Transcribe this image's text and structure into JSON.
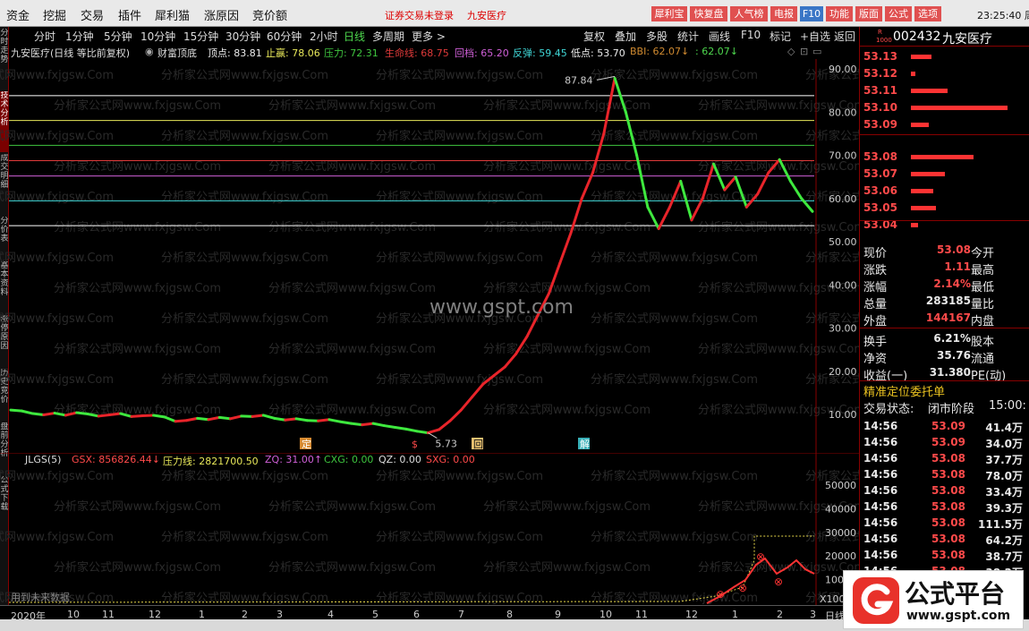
{
  "menu": {
    "items": [
      "资金",
      "挖掘",
      "交易",
      "插件",
      "犀利猫",
      "涨原因",
      "竞价额"
    ],
    "notice": "证券交易未登录",
    "notice_stock": "九安医疗",
    "buttons": [
      "犀利宝",
      "快复盘",
      "人气榜",
      "电报",
      "F10",
      "功能",
      "版面",
      "公式",
      "选项"
    ],
    "clock": "23:25:40 周一"
  },
  "side_tabs": [
    "分时走势",
    "技术分析",
    "成交明细",
    "分价表",
    "基本资料",
    "涨停原因",
    "历史竞价",
    "盘前分析",
    "公式下载"
  ],
  "periods": [
    "分时",
    "1分钟",
    "5分钟",
    "10分钟",
    "15分钟",
    "30分钟",
    "60分钟",
    "2小时",
    "日线",
    "多周期",
    "更多 >"
  ],
  "active_period": "日线",
  "toolbar": [
    "复权",
    "叠加",
    "多股",
    "统计",
    "画线",
    "F10",
    "标记",
    "+自选",
    "返回"
  ],
  "info": {
    "name": "九安医疗(日线 等比前复权)",
    "indicator": "财富顶底",
    "top": "顶点: 83.81",
    "stop_profit": "止赢: 78.06",
    "pressure": "压力: 72.31",
    "lifeline": "生命线: 68.75",
    "pullback": "回档: 65.20",
    "rebound": "反弹: 59.45",
    "low": "低点: 53.70",
    "bbi": "BBI: 62.07↓",
    "bbi2": ": 62.07↓"
  },
  "markers": [
    {
      "label": "定",
      "date": "2020-03"
    },
    {
      "label": "$",
      "date": "2020-06"
    },
    {
      "label": "回",
      "date": "2020-07"
    },
    {
      "label": "解",
      "date": "2020-10"
    }
  ],
  "annotations": {
    "high": "87.84",
    "low": "5.73"
  },
  "watermark": "www.gspt.com",
  "watermark_repeat": "分析家公式网www.fxjgsw.Com",
  "levels": [
    {
      "label": "顶点",
      "value": 83.81,
      "color": "#ffffff"
    },
    {
      "label": "止赢",
      "value": 78.06,
      "color": "#e8e85a"
    },
    {
      "label": "压力",
      "value": 72.31,
      "color": "#3fc63f"
    },
    {
      "label": "生命线",
      "value": 68.75,
      "color": "#e03a3a"
    },
    {
      "label": "回档",
      "value": 65.2,
      "color": "#d060d8"
    },
    {
      "label": "反弹",
      "value": 59.45,
      "color": "#40d8d8"
    },
    {
      "label": "低点",
      "value": 53.7,
      "color": "#ffffff"
    }
  ],
  "main_axis": [
    "90.00",
    "80.00",
    "70.00",
    "60.00",
    "50.00",
    "40.00",
    "30.00",
    "20.00",
    "10.00"
  ],
  "volume": {
    "indicator": "JLGS(5)",
    "gsx": "GSX: 856826.44↓",
    "pressure": "压力线: 2821700.50",
    "zq": "ZQ: 31.00↑",
    "cxg": "CXG: 0.00",
    "qz": "QZ: 0.00",
    "sxg": "SXG: 0.00",
    "axis": [
      "50000",
      "40000",
      "30000",
      "20000",
      "10000"
    ],
    "unit": "X100",
    "note": "用到未来数据"
  },
  "time_axis": [
    "2020年",
    "10",
    "11",
    "12",
    "1",
    "2",
    "3",
    "4",
    "5",
    "6",
    "7",
    "8",
    "9",
    "10",
    "11",
    "12",
    "1",
    "2",
    "3"
  ],
  "time_end": "日线",
  "stock": {
    "code": "002432",
    "name": "九安医疗",
    "badge_r": "R",
    "badge_n": "1000"
  },
  "orderbook": [
    {
      "price": "53.13",
      "vol": 18
    },
    {
      "price": "53.12",
      "vol": 4
    },
    {
      "price": "53.11",
      "vol": 32
    },
    {
      "price": "53.10",
      "vol": 85
    },
    {
      "price": "53.09",
      "vol": 16
    },
    {
      "price": "53.08",
      "vol": 55
    },
    {
      "price": "53.07",
      "vol": 30
    },
    {
      "price": "53.06",
      "vol": 20
    },
    {
      "price": "53.05",
      "vol": 22
    },
    {
      "price": "53.04",
      "vol": 6
    }
  ],
  "quote": [
    {
      "l": "现价",
      "v": "53.08",
      "r": "今开",
      "c": "#ff4a4a"
    },
    {
      "l": "涨跌",
      "v": "1.11",
      "r": "最高",
      "c": "#ff4a4a"
    },
    {
      "l": "涨幅",
      "v": "2.14%",
      "r": "最低",
      "c": "#ff4a4a"
    },
    {
      "l": "总量",
      "v": "283185",
      "r": "量比",
      "c": "#e8e8e8"
    },
    {
      "l": "外盘",
      "v": "144167",
      "r": "内盘",
      "c": "#ff4a4a"
    },
    {
      "l": "换手",
      "v": "6.21%",
      "r": "股本",
      "c": "#e8e8e8"
    },
    {
      "l": "净资",
      "v": "35.76",
      "r": "流通",
      "c": "#e8e8e8"
    },
    {
      "l": "收益(一)",
      "v": "31.380",
      "r": "PE(动)",
      "c": "#e8e8e8"
    }
  ],
  "order_title": "精准定位委托单",
  "trade_status_label": "交易状态:",
  "trade_status": "闭市阶段",
  "trade_time": "15:00:",
  "ticks": [
    {
      "t": "14:56",
      "p": "53.09",
      "v": "41.4万"
    },
    {
      "t": "14:56",
      "p": "53.09",
      "v": "34.0万"
    },
    {
      "t": "14:56",
      "p": "53.08",
      "v": "37.7万"
    },
    {
      "t": "14:56",
      "p": "53.08",
      "v": "78.0万"
    },
    {
      "t": "14:56",
      "p": "53.08",
      "v": "33.4万"
    },
    {
      "t": "14:56",
      "p": "53.08",
      "v": "39.3万"
    },
    {
      "t": "14:56",
      "p": "53.08",
      "v": "111.5万"
    },
    {
      "t": "14:56",
      "p": "53.08",
      "v": "64.2万"
    },
    {
      "t": "14:56",
      "p": "53.08",
      "v": "38.7万"
    },
    {
      "t": "14:56",
      "p": "53.08",
      "v": "38.2万"
    }
  ],
  "logo": {
    "text": "公式平台",
    "url": "www.gspt.com"
  },
  "price_series": [
    11,
    10.8,
    10.2,
    9.9,
    10.3,
    9.8,
    10.4,
    10.1,
    9.6,
    9.9,
    10.2,
    9.5,
    9.7,
    9.8,
    9.4,
    8.4,
    8.6,
    9.1,
    8.8,
    9.3,
    9.0,
    9.6,
    9.5,
    9.8,
    9.1,
    8.7,
    9.0,
    8.6,
    8.5,
    8.8,
    8.3,
    7.9,
    7.6,
    7.9,
    7.4,
    7.0,
    6.6,
    6.1,
    5.73,
    6.5,
    8.5,
    11,
    14,
    17,
    19,
    21,
    24,
    28,
    33,
    38,
    45,
    52,
    60,
    66,
    75,
    87.84,
    80,
    70,
    58,
    53,
    58,
    64,
    55,
    60,
    68,
    62,
    65,
    58,
    61,
    66,
    69,
    64,
    60,
    57
  ]
}
